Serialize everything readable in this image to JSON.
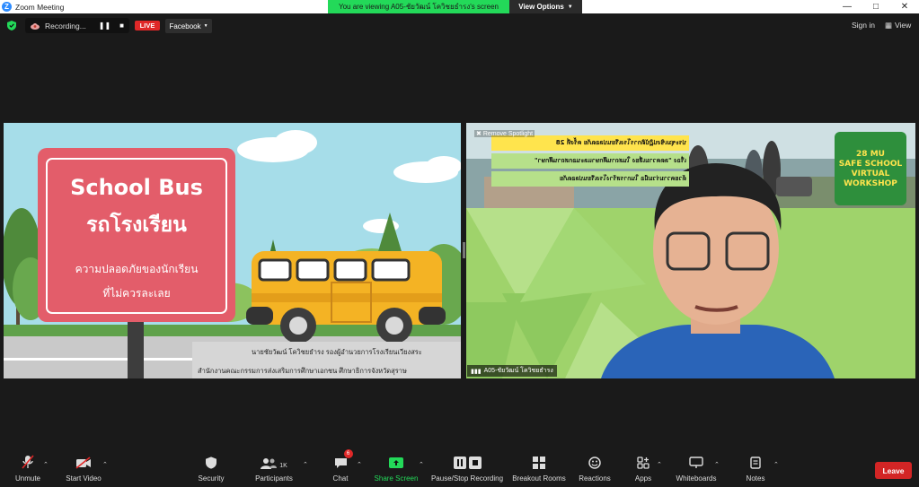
{
  "window": {
    "title": "Zoom Meeting",
    "app_icon": "Z",
    "controls": [
      "—",
      "□",
      "✕"
    ]
  },
  "banner": {
    "viewing_text": "You are viewing A05-ชัยวัฒน์ โควิชยธำรง's screen",
    "view_options": "View Options"
  },
  "top_bar": {
    "recording_label": "Recording...",
    "live_label": "LIVE",
    "stream_target": "Facebook",
    "sign_in": "Sign in",
    "view": "View"
  },
  "shared_screen": {
    "sign_title_en": "School Bus",
    "sign_title_th": "รถโรงเรียน",
    "sign_line1": "ความปลอดภัยของนักเรียน",
    "sign_line2": "ที่ไม่ควรละเลย",
    "credit_line1": "นายชัยวัฒน์ โควิชยธำรง รองผู้อำนวยการโรงเรียนเวียงสระ",
    "credit_line2": "สำนักงานคณะกรรมการส่งเสริมการศึกษาเอกชน ศึกษาธิการจังหวัดสุราษ"
  },
  "participant": {
    "remove_spotlight": "Remove Spotlight",
    "name": "A05-ชัยวัฒน์ โควิชยธำรง",
    "workshop_badge": {
      "line1": "28 MU",
      "line2": "SAFE SCHOOL",
      "line3": "VIRTUAL",
      "line4": "WORKSHOP",
      "ordinal": "th"
    },
    "banner_lines": [
      "ประชุมเชิงปฏิบัติการโรงเรียนปลอดภัย ครั้งที่ 28",
      "เรื่อง \"ลดความเสี่ยง ในสถานศึกษาและนอกสถานศึกษา\"",
      "ด้วยความร่วมมือ ในการสร้างโรงเรียนปลอดภัย"
    ]
  },
  "toolbar": {
    "unmute": "Unmute",
    "start_video": "Start Video",
    "security": "Security",
    "participants": "Participants",
    "participants_count": "1K",
    "chat": "Chat",
    "chat_badge": "6",
    "share_screen": "Share Screen",
    "pause_stop_recording": "Pause/Stop Recording",
    "breakout_rooms": "Breakout Rooms",
    "reactions": "Reactions",
    "apps": "Apps",
    "whiteboards": "Whiteboards",
    "notes": "Notes",
    "leave": "Leave"
  },
  "colors": {
    "share_green": "#23d959",
    "live_red": "#e02828",
    "leave_red": "#d32525",
    "sign_red": "#e35d6a",
    "bus_yellow": "#f4b324"
  }
}
